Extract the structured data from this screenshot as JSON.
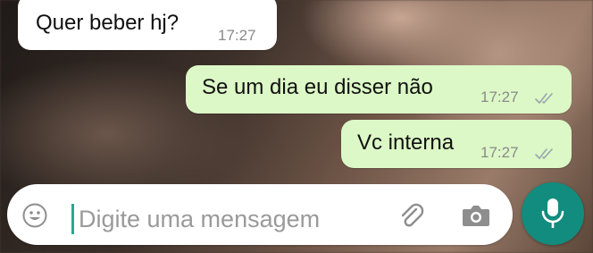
{
  "conversation": {
    "messages": [
      {
        "direction": "incoming",
        "text": "Quer beber hj?",
        "time": "17:27"
      },
      {
        "direction": "outgoing",
        "text": "Se um dia eu disser não",
        "time": "17:27",
        "status": "read"
      },
      {
        "direction": "outgoing",
        "text": "Vc interna",
        "time": "17:27",
        "status": "read"
      }
    ]
  },
  "composer": {
    "placeholder": "Digite uma mensagem",
    "icons": {
      "emoji": "emoji-icon",
      "attach": "paperclip-icon",
      "camera": "camera-icon",
      "mic": "microphone-icon"
    }
  },
  "colors": {
    "incoming_bubble": "#ffffff",
    "outgoing_bubble": "#dcf8c6",
    "accent": "#128c7e",
    "caret": "#2aa88f",
    "ticks": "#9aa5ad"
  }
}
